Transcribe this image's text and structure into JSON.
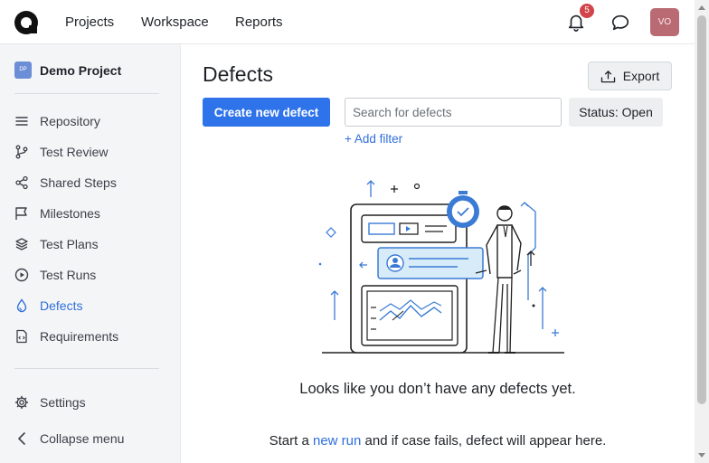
{
  "topnav": {
    "items": [
      "Projects",
      "Workspace",
      "Reports"
    ],
    "notifications_count": "5",
    "avatar_initials": "VO"
  },
  "sidebar": {
    "project_badge": "DP",
    "project_name": "Demo Project",
    "items": [
      {
        "label": "Repository",
        "icon": "repository-icon"
      },
      {
        "label": "Test Review",
        "icon": "branch-icon"
      },
      {
        "label": "Shared Steps",
        "icon": "share-icon"
      },
      {
        "label": "Milestones",
        "icon": "flag-icon"
      },
      {
        "label": "Test Plans",
        "icon": "layers-icon"
      },
      {
        "label": "Test Runs",
        "icon": "play-circle-icon"
      },
      {
        "label": "Defects",
        "icon": "bug-drop-icon",
        "active": true
      },
      {
        "label": "Requirements",
        "icon": "document-code-icon"
      }
    ],
    "settings_label": "Settings",
    "collapse_label": "Collapse menu"
  },
  "main": {
    "title": "Defects",
    "export_label": "Export",
    "create_label": "Create new defect",
    "search_placeholder": "Search for defects",
    "status_label": "Status: Open",
    "add_filter_label": "+ Add filter",
    "empty_title": "Looks like you don’t have any defects yet.",
    "empty_sub_before": "Start a",
    "empty_sub_link": "new run",
    "empty_sub_after": "and if case fails, defect will appear here."
  },
  "colors": {
    "accent": "#2f73ea",
    "badge": "#d2434a",
    "avatar": "#b96a72",
    "active_nav": "#2f6fdc"
  }
}
